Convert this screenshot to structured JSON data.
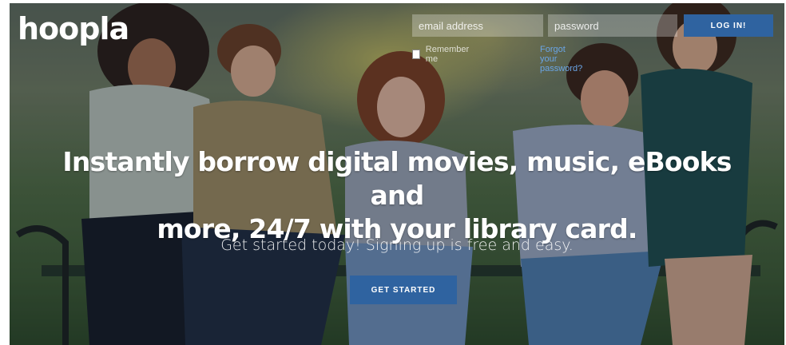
{
  "brand": {
    "logo_text": "hoopla"
  },
  "login": {
    "email_placeholder": "email address",
    "password_placeholder": "password",
    "login_label": "LOG IN!",
    "remember_label": "Remember me",
    "forgot_label": "Forgot your password?"
  },
  "hero": {
    "headline_line1": "Instantly borrow digital movies, music, eBooks and",
    "headline_line2": "more, 24/7 with your library card.",
    "subtitle": "Get started today! Signing up is free and easy.",
    "cta_label": "GET STARTED"
  },
  "colors": {
    "button_blue": "#2f63a0",
    "link_blue": "#6aa5e6"
  }
}
